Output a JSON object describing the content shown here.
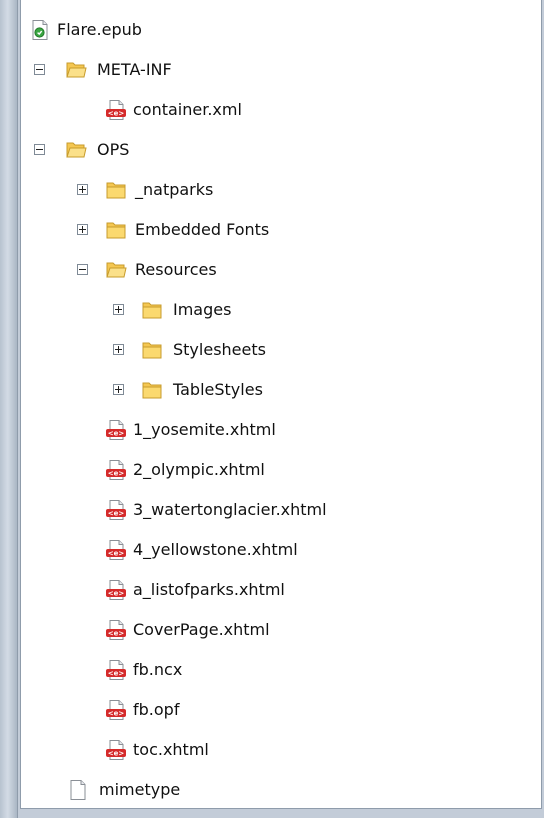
{
  "tree": {
    "root": {
      "label": "Flare.epub",
      "icon": "epub-icon"
    },
    "meta_inf": {
      "label": "META-INF",
      "icon": "folder-open-icon",
      "expanded": true
    },
    "container_xml": {
      "label": "container.xml",
      "icon": "xml-file-icon"
    },
    "ops": {
      "label": "OPS",
      "icon": "folder-open-icon",
      "expanded": true
    },
    "natparks": {
      "label": "_natparks",
      "icon": "folder-icon",
      "expanded": false
    },
    "embedded_fonts": {
      "label": "Embedded Fonts",
      "icon": "folder-icon",
      "expanded": false
    },
    "resources": {
      "label": "Resources",
      "icon": "folder-open-icon",
      "expanded": true
    },
    "images": {
      "label": "Images",
      "icon": "folder-icon",
      "expanded": false
    },
    "stylesheets": {
      "label": "Stylesheets",
      "icon": "folder-icon",
      "expanded": false
    },
    "tablestyles": {
      "label": "TableStyles",
      "icon": "folder-icon",
      "expanded": false
    },
    "files": [
      {
        "label": "1_yosemite.xhtml",
        "icon": "xml-file-icon"
      },
      {
        "label": "2_olympic.xhtml",
        "icon": "xml-file-icon"
      },
      {
        "label": "3_watertonglacier.xhtml",
        "icon": "xml-file-icon"
      },
      {
        "label": "4_yellowstone.xhtml",
        "icon": "xml-file-icon"
      },
      {
        "label": "a_listofparks.xhtml",
        "icon": "xml-file-icon"
      },
      {
        "label": "CoverPage.xhtml",
        "icon": "xml-file-icon"
      },
      {
        "label": "fb.ncx",
        "icon": "xml-file-icon"
      },
      {
        "label": "fb.opf",
        "icon": "xml-file-icon"
      },
      {
        "label": "toc.xhtml",
        "icon": "xml-file-icon"
      }
    ],
    "mimetype": {
      "label": "mimetype",
      "icon": "blank-file-icon"
    }
  }
}
